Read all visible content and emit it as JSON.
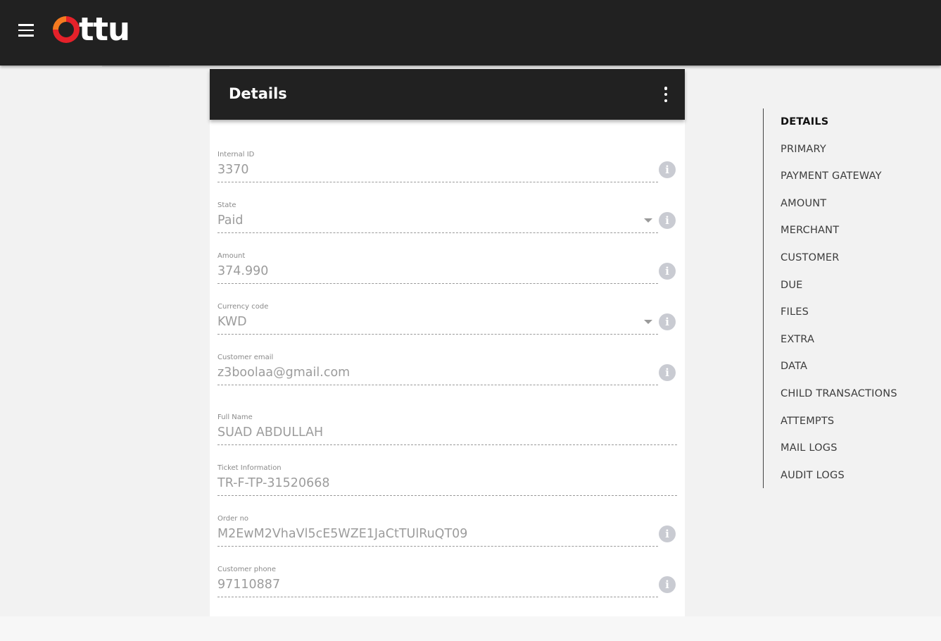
{
  "header": {
    "logo_text": "ttu",
    "brand_colors": {
      "ring_orange": "#f47a20",
      "ring_red": "#e5212a",
      "bar_bg": "#212121"
    },
    "menu_icon": "hamburger-menu-icon"
  },
  "card": {
    "title": "Details",
    "more_icon": "more-vertical-icon",
    "fields": [
      {
        "label": "Internal ID",
        "value": "3370",
        "info": true,
        "dropdown": false
      },
      {
        "label": "State",
        "value": "Paid",
        "info": true,
        "dropdown": true
      },
      {
        "label": "Amount",
        "value": "374.990",
        "info": true,
        "dropdown": false
      },
      {
        "label": "Currency code",
        "value": "KWD",
        "info": true,
        "dropdown": true
      },
      {
        "label": "Customer email",
        "value": "z3boolaa@gmail.com",
        "info": true,
        "dropdown": false
      },
      {
        "label": "Full Name",
        "value": "SUAD ABDULLAH",
        "info": false,
        "dropdown": false
      },
      {
        "label": "Ticket Information",
        "value": "TR-F-TP-31520668",
        "info": false,
        "dropdown": false
      },
      {
        "label": "Order no",
        "value": "M2EwM2VhaVl5cE5WZE1JaCtTUlRuQT09",
        "info": true,
        "dropdown": false
      },
      {
        "label": "Customer phone",
        "value": "97110887",
        "info": true,
        "dropdown": false
      }
    ]
  },
  "side_nav": {
    "items": [
      {
        "label": "DETAILS",
        "active": true
      },
      {
        "label": "PRIMARY",
        "active": false
      },
      {
        "label": "PAYMENT GATEWAY",
        "active": false
      },
      {
        "label": "AMOUNT",
        "active": false
      },
      {
        "label": "MERCHANT",
        "active": false
      },
      {
        "label": "CUSTOMER",
        "active": false
      },
      {
        "label": "DUE",
        "active": false
      },
      {
        "label": "FILES",
        "active": false
      },
      {
        "label": "EXTRA",
        "active": false
      },
      {
        "label": "DATA",
        "active": false
      },
      {
        "label": "CHILD TRANSACTIONS",
        "active": false
      },
      {
        "label": "ATTEMPTS",
        "active": false
      },
      {
        "label": "MAIL LOGS",
        "active": false
      },
      {
        "label": "AUDIT LOGS",
        "active": false
      }
    ]
  }
}
